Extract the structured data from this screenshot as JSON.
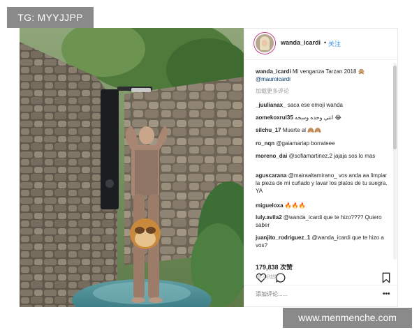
{
  "watermark_top": "TG: MYYJJPP",
  "watermark_bottom": "www.menmenche.com",
  "post": {
    "author": "wanda_icardi",
    "dot": "•",
    "follow_label": "关注",
    "caption_user": "wanda_icardi",
    "caption_text": "Mi venganza Tarzan 2018 🙊",
    "caption_mention": "@mauroicardi",
    "load_more": "加载更多评论",
    "comments": [
      {
        "user": "_juulianax_",
        "text": "saca ese emoji wanda"
      },
      {
        "user": "aomekoxrul35",
        "text": "انتي وحده وسخه 😂"
      },
      {
        "user": "silchu_17",
        "text": "Muerte al 🙈🙈"
      },
      {
        "user": "ro_nqn",
        "text": "@gaiamariap borrateee"
      },
      {
        "user": "moreno_dai",
        "text": "@sofiamartinez.2 jajaja sos lo mas"
      },
      {
        "user": "aguscarana",
        "text": "@mairaaltamirano_ vos anda aa limpiar la pieza de mi cuñado y lavar los platos de tu suegra. YA"
      },
      {
        "user": "migueloxa",
        "text": "🔥🔥🔥"
      },
      {
        "user": "luly.avila2",
        "text": "@wanda_icardi que te hizo???? Quiero saber"
      },
      {
        "user": "juanjito_rodriguez_1",
        "text": "@wanda_icardi que te hizo a vos?"
      }
    ],
    "likes": "179,838 次赞",
    "time": "18 小时前",
    "add_comment_placeholder": "添加评论......",
    "more_label": "•••"
  },
  "icons": {
    "like": "heart-icon",
    "comment": "comment-bubble-icon",
    "save": "bookmark-icon"
  },
  "colors": {
    "link_blue": "#3897f0",
    "mention": "#003569",
    "watermark_bg": "#8a8a8a"
  }
}
